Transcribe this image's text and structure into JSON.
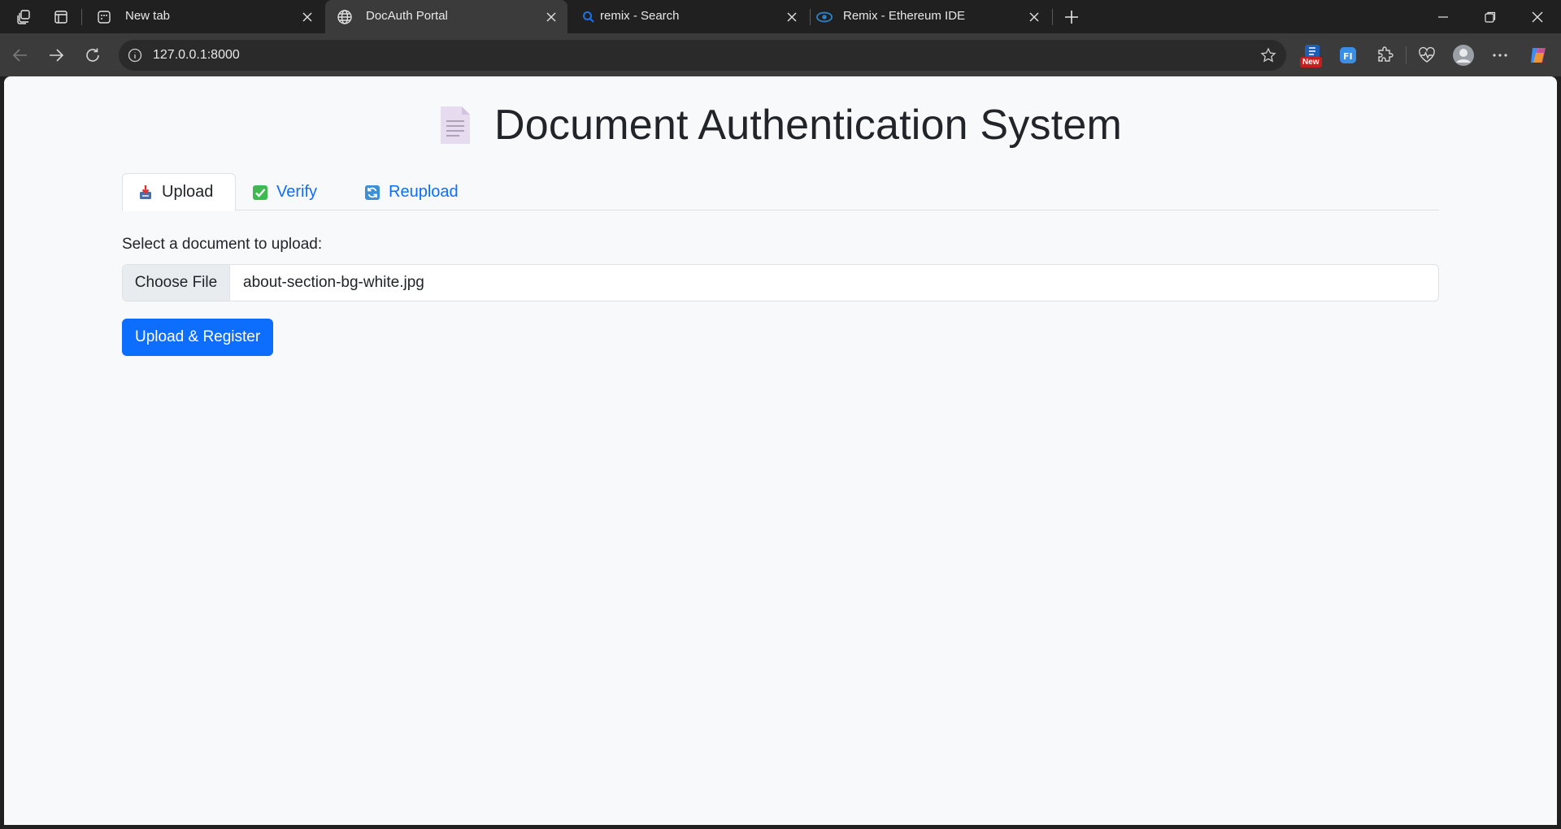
{
  "browser": {
    "tabs": [
      {
        "title": "New tab",
        "active": false
      },
      {
        "title": "DocAuth Portal",
        "active": true
      },
      {
        "title": "remix - Search",
        "active": false
      },
      {
        "title": "Remix - Ethereum IDE",
        "active": false
      }
    ],
    "address_url": "127.0.0.1:8000",
    "extension_badge": "New"
  },
  "page": {
    "heading": "Document Authentication System",
    "nav_tabs": [
      {
        "label": "Upload",
        "active": true,
        "icon": "inbox-tray-icon"
      },
      {
        "label": "Verify",
        "active": false,
        "icon": "check-mark-icon"
      },
      {
        "label": "Reupload",
        "active": false,
        "icon": "refresh-icon"
      }
    ],
    "form_label": "Select a document to upload:",
    "choose_file_label": "Choose File",
    "selected_file": "about-section-bg-white.jpg",
    "submit_label": "Upload & Register"
  },
  "colors": {
    "primary": "#0d6efd",
    "page_bg": "#f8f9fa",
    "chrome_dark": "#202020",
    "toolbar": "#3b3b3b"
  }
}
